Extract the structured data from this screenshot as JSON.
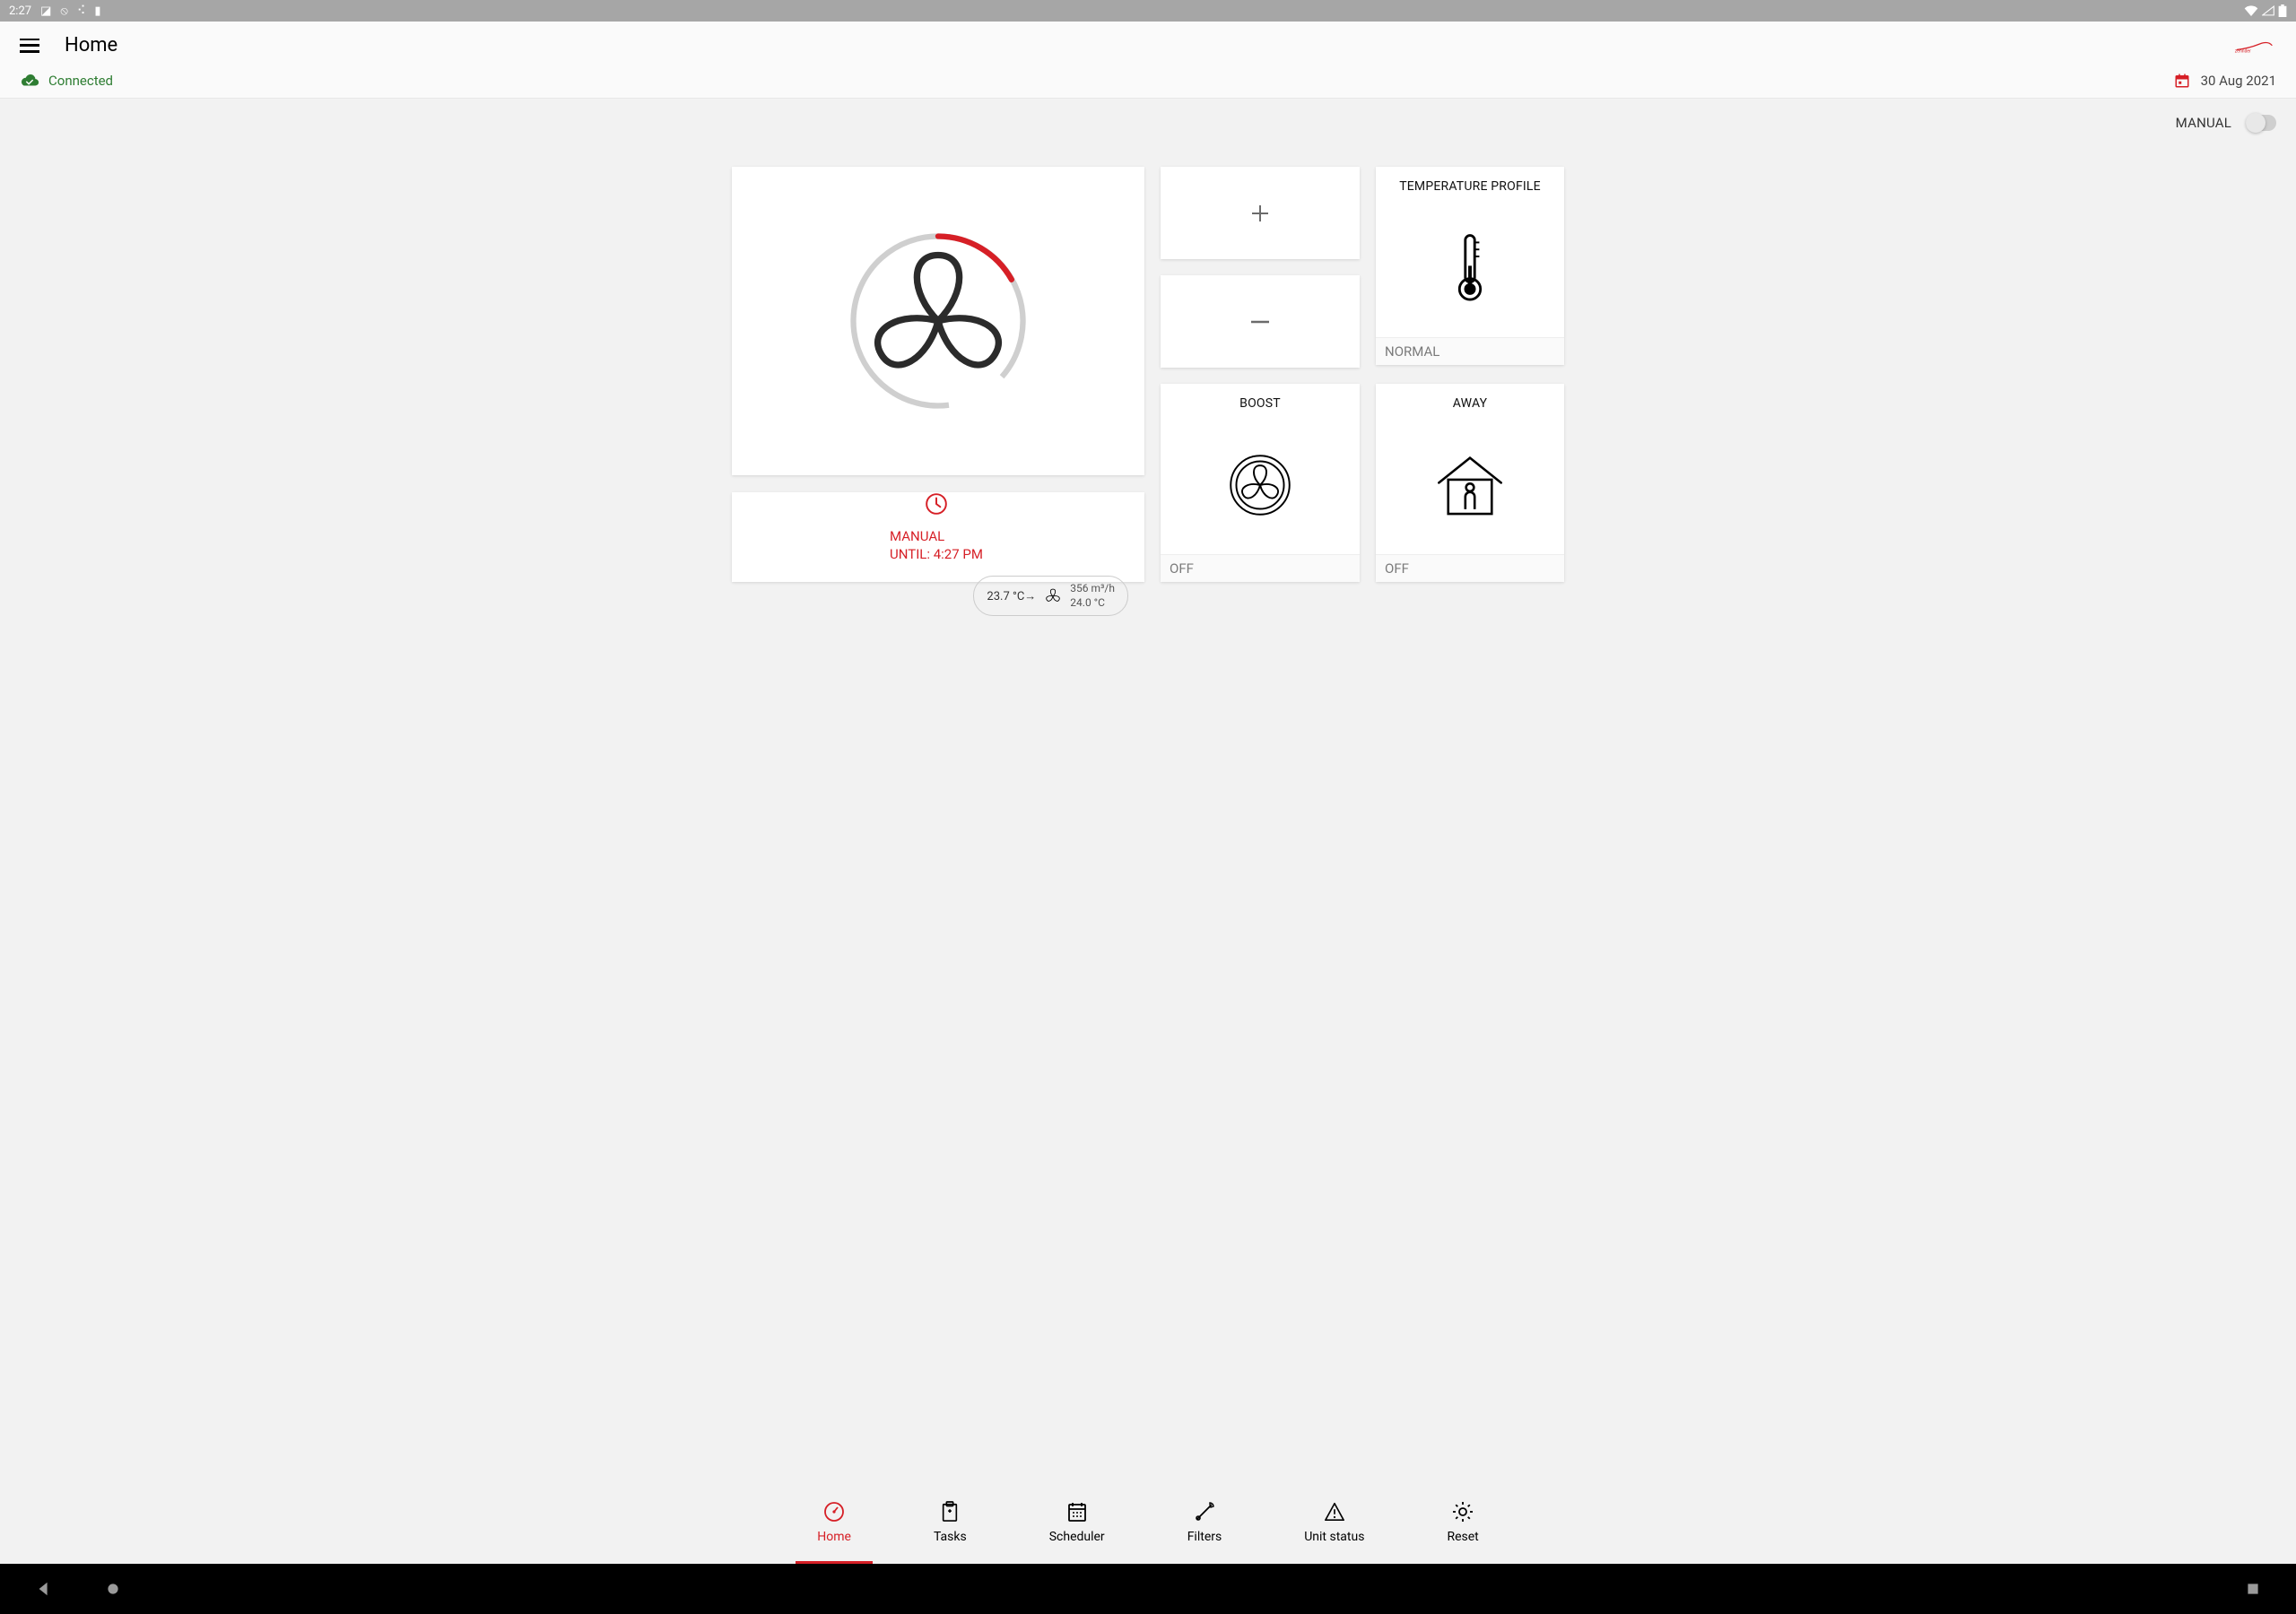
{
  "status_bar": {
    "time": "2:27"
  },
  "header": {
    "title": "Home",
    "connected_label": "Connected",
    "date": "30 Aug 2021"
  },
  "mode": {
    "label": "MANUAL",
    "on": false
  },
  "schedule": {
    "line1": "MANUAL",
    "line2": "UNTIL: 4:27 PM",
    "temp_in": "23.7 °C→",
    "airflow": "356 m³/h",
    "temp_out": "24.0 °C"
  },
  "tiles": {
    "temp_profile": {
      "title": "TEMPERATURE PROFILE",
      "footer": "NORMAL"
    },
    "boost": {
      "title": "BOOST",
      "footer": "OFF"
    },
    "away": {
      "title": "AWAY",
      "footer": "OFF"
    }
  },
  "nav": {
    "items": [
      {
        "label": "Home"
      },
      {
        "label": "Tasks"
      },
      {
        "label": "Scheduler"
      },
      {
        "label": "Filters"
      },
      {
        "label": "Unit status"
      },
      {
        "label": "Reset"
      }
    ]
  }
}
